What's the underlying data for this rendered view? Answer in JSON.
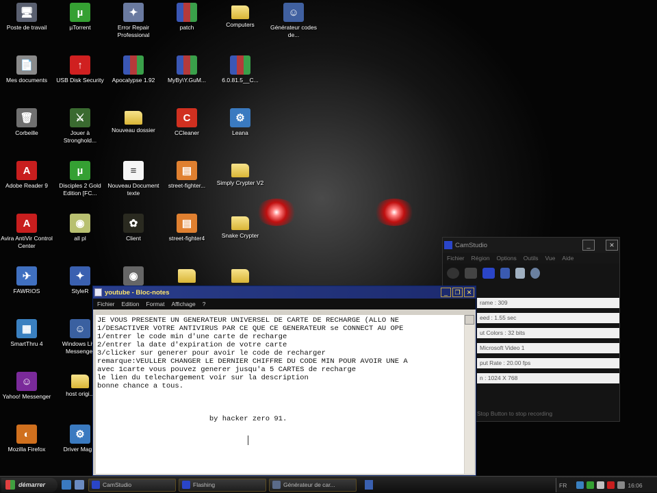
{
  "desktop": {
    "icons": [
      {
        "label": "Poste de travail",
        "glyph": "🖥",
        "color": "#5a6070"
      },
      {
        "label": "µTorrent",
        "glyph": "µ",
        "color": "#35a033"
      },
      {
        "label": "Error Repair Professional",
        "glyph": "✦",
        "color": "#6a7aa0"
      },
      {
        "label": "patch",
        "glyph": "",
        "color": "rar"
      },
      {
        "label": "Computers",
        "glyph": "",
        "color": "folder"
      },
      {
        "label": "Générateur codes de...",
        "glyph": "☺",
        "color": "#4060a0"
      },
      {
        "label": "Mes documents",
        "glyph": "📄",
        "color": "#8a8a8a"
      },
      {
        "label": "USB Disk Security",
        "glyph": "↑",
        "color": "#d02020"
      },
      {
        "label": "Apocalypse 1.92",
        "glyph": "",
        "color": "rar"
      },
      {
        "label": "MyBy\\Y.GuM...",
        "glyph": "",
        "color": "rar"
      },
      {
        "label": "6.0.81.5__C...",
        "glyph": "",
        "color": "rar"
      },
      {
        "label": "Corbeille",
        "glyph": "🗑",
        "color": "#707070"
      },
      {
        "label": "Jouer à Stronghold...",
        "glyph": "⚔",
        "color": "#3a6a30"
      },
      {
        "label": "Nouveau dossier",
        "glyph": "",
        "color": "folder"
      },
      {
        "label": "CCleaner",
        "glyph": "C",
        "color": "#d03020"
      },
      {
        "label": "Leana",
        "glyph": "⚙",
        "color": "#3a7ac0"
      },
      {
        "label": "Adobe Reader 9",
        "glyph": "A",
        "color": "#c81e1e"
      },
      {
        "label": "Disciples 2 Gold Edition [FC...",
        "glyph": "µ",
        "color": "#35a033"
      },
      {
        "label": "Nouveau Document texte",
        "glyph": "",
        "color": "doc"
      },
      {
        "label": "street-fighter...",
        "glyph": "▤",
        "color": "#e08030"
      },
      {
        "label": "Simply Crypter V2",
        "glyph": "",
        "color": "folder"
      },
      {
        "label": "Avira AntiVir Control Center",
        "glyph": "A",
        "color": "#c81e1e"
      },
      {
        "label": "all pl",
        "glyph": "◉",
        "color": "#b8c070"
      },
      {
        "label": "Client",
        "glyph": "✿",
        "color": "#2a2a20"
      },
      {
        "label": "street-fighter4",
        "glyph": "▤",
        "color": "#e08030"
      },
      {
        "label": "Snake Crypter",
        "glyph": "",
        "color": "folder"
      },
      {
        "label": "FAWRIOS",
        "glyph": "✈",
        "color": "#4070c0"
      },
      {
        "label": "StyleR",
        "glyph": "✦",
        "color": "#3a60b0"
      },
      {
        "label": "",
        "glyph": "◉",
        "color": "#666"
      },
      {
        "label": "",
        "glyph": "",
        "color": "folder"
      },
      {
        "label": "",
        "glyph": "",
        "color": "folder"
      },
      {
        "label": "SmartThru 4",
        "glyph": "▦",
        "color": "#3a80c0"
      },
      {
        "label": "Windows Live Messenger",
        "glyph": "☺",
        "color": "#3a60a0"
      },
      {
        "label": "Yahoo! Messenger",
        "glyph": "☺",
        "color": "#7a2a9a"
      },
      {
        "label": "host origi...",
        "glyph": "",
        "color": "folder"
      },
      {
        "label": "Mozilla Firefox",
        "glyph": "◐",
        "color": "#d0701e"
      },
      {
        "label": "Driver Mag...",
        "glyph": "⚙",
        "color": "#3a7ac0"
      }
    ]
  },
  "notepad": {
    "title": "youtube - Bloc-notes",
    "menu": [
      "Fichier",
      "Edition",
      "Format",
      "Affichage",
      "?"
    ],
    "content": "JE VOUS PRESENTE UN GENERATEUR UNIVERSEL DE CARTE DE RECHARGE (ALLO NE\n1/DESACTIVER VOTRE ANTIVIRUS PAR CE QUE CE GENERATEUR se CONNECT AU OPE\n1/entrer le code min d'une carte de recharge\n2/entrer la date d'expiration de votre carte\n3/clicker sur generer pour avoir le code de recharger\nremarque:VEULLER CHANGER LE DERNIER CHIFFRE DU CODE MIN POUR AVOIR UNE A\navec 1carte vous pouvez generer jusqu'a 5 CARTES de recharge\nle lien du telechargement voir sur la description\nbonne chance a tous.\n\n\n\n                          by hacker zero 91."
  },
  "camstudio": {
    "title": "CamStudio",
    "menu": [
      "Fichier",
      "Région",
      "Options",
      "Outils",
      "Vue",
      "Aide"
    ],
    "stats": [
      "rame : 309",
      "eed : 1.55 sec",
      "ut Colors : 32 bits",
      "Microsoft Video 1",
      "put Rate : 20.00 fps",
      "n : 1024 X 768"
    ],
    "footer": "Stop Button to stop recording"
  },
  "taskbar": {
    "start_label": "démarrer",
    "tasks": [
      "CamStudio",
      "Flashing",
      "Générateur de car..."
    ],
    "tray_lang": "FR",
    "clock": "16:06"
  }
}
